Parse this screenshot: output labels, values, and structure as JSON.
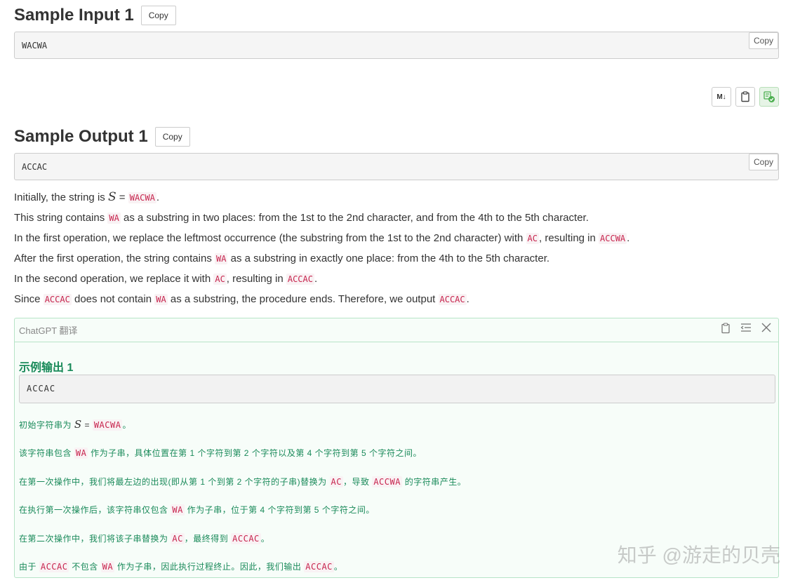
{
  "sample_input": {
    "title": "Sample Input 1",
    "copy_label": "Copy",
    "content": "WACWA",
    "box_copy_label": "Copy"
  },
  "toolbar": {
    "markdown_label": "M↓",
    "clipboard_icon": "clipboard-icon",
    "translate_icon": "translate-check-icon",
    "accent_color": "#4caf50"
  },
  "sample_output": {
    "title": "Sample Output 1",
    "copy_label": "Copy",
    "content": "ACCAC",
    "box_copy_label": "Copy"
  },
  "explanation": {
    "p1": {
      "t1": "Initially, the string is ",
      "var": "S",
      "eq": " = ",
      "c1": "WACWA",
      "t2": "."
    },
    "p2": {
      "t1": "This string contains ",
      "c1": "WA",
      "t2": " as a substring in two places: from the 1st to the 2nd character, and from the 4th to the 5th character."
    },
    "p3": {
      "t1": "In the first operation, we replace the leftmost occurrence (the substring from the 1st to the 2nd character) with ",
      "c1": "AC",
      "t2": ", resulting in ",
      "c2": "ACCWA",
      "t3": "."
    },
    "p4": {
      "t1": "After the first operation, the string contains ",
      "c1": "WA",
      "t2": " as a substring in exactly one place: from the 4th to the 5th character."
    },
    "p5": {
      "t1": "In the second operation, we replace it with ",
      "c1": "AC",
      "t2": ", resulting in ",
      "c2": "ACCAC",
      "t3": "."
    },
    "p6": {
      "t1": "Since ",
      "c1": "ACCAC",
      "t2": " does not contain ",
      "c2": "WA",
      "t3": " as a substring, the procedure ends. Therefore, we output ",
      "c3": "ACCAC",
      "t4": "."
    }
  },
  "translation_panel": {
    "header": "ChatGPT 翻译",
    "title": "示例输出 1",
    "content": "ACCAC",
    "accent_color": "#1a8a5a",
    "p1": {
      "t1": "初始字符串为 ",
      "var": "S",
      "eq": " = ",
      "c1": "WACWA",
      "t2": "。"
    },
    "p2": {
      "t1": "该字符串包含 ",
      "c1": "WA",
      "t2": " 作为子串，具体位置在第 1 个字符到第 2 个字符以及第 4 个字符到第 5 个字符之间。"
    },
    "p3": {
      "t1": "在第一次操作中，我们将最左边的出现(即从第 1 个到第 2 个字符的子串)替换为 ",
      "c1": "AC",
      "t2": "，导致 ",
      "c2": "ACCWA",
      "t3": " 的字符串产生。"
    },
    "p4": {
      "t1": "在执行第一次操作后，该字符串仅包含 ",
      "c1": "WA",
      "t2": " 作为子串，位于第 4 个字符到第 5 个字符之间。"
    },
    "p5": {
      "t1": "在第二次操作中，我们将该子串替换为 ",
      "c1": "AC",
      "t2": "，最终得到 ",
      "c2": "ACCAC",
      "t3": "。"
    },
    "p6": {
      "t1": "由于 ",
      "c1": "ACCAC",
      "t2": " 不包含 ",
      "c2": "WA",
      "t3": " 作为子串，因此执行过程终止。因此，我们输出 ",
      "c3": "ACCAC",
      "t4": "。"
    }
  },
  "watermark": "知乎 @游走的贝壳"
}
